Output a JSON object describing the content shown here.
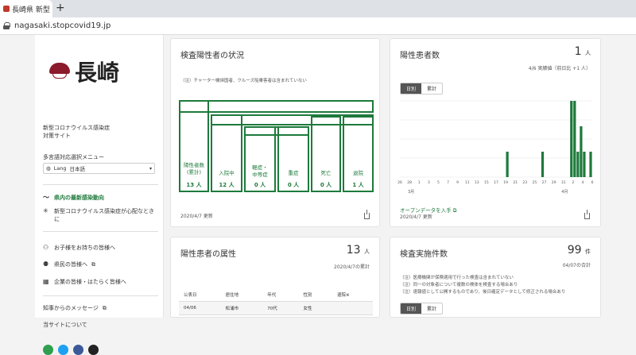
{
  "browser": {
    "tab_title": "長崎県 新型",
    "tab_close": "×",
    "new_tab": "+",
    "url": "nagasaki.stopcovid19.jp"
  },
  "sidebar": {
    "logo_text": "長崎",
    "subtitle_1": "新型コロナウイルス感染症",
    "subtitle_2": "対策サイト",
    "lang_menu_label": "多言語対応選択メニュー",
    "lang_prefix": "Lang",
    "lang_value": "日本語",
    "items": [
      {
        "label": "県内の最新感染動向",
        "icon": "chart-line-icon",
        "glyph": "〜",
        "active": true
      },
      {
        "label": "新型コロナウイルス感染症が心配なときに",
        "icon": "virus-icon",
        "glyph": "✳",
        "active": false
      },
      {
        "label": "お子様をお持ちの皆様へ",
        "icon": "family-icon",
        "glyph": "👪",
        "active": false
      },
      {
        "label": "県民の皆様へ",
        "icon": "people-icon",
        "glyph": "👥",
        "active": false
      },
      {
        "label": "企業の皆様・はたらく皆様へ",
        "icon": "building-icon",
        "glyph": "▦",
        "active": false
      },
      {
        "label": "知事からのメッセージ",
        "icon": "external-link-icon",
        "glyph": "",
        "active": false
      },
      {
        "label": "当サイトについて",
        "icon": "",
        "glyph": "",
        "active": false
      }
    ],
    "social_colors": [
      "#2e9e4f",
      "#1da1f2",
      "#3b5998",
      "#222222"
    ]
  },
  "card_status": {
    "title": "検査陽性者の状況",
    "note": "（注）チャーター機帰国者、クルーズ船乗客者は含まれていない",
    "boxes": [
      {
        "label": "陽性者数\n(累計)",
        "value": "13 人"
      },
      {
        "label": "入院中",
        "value": "12 人"
      },
      {
        "label": "軽症・\n中等症",
        "value": "0 人"
      },
      {
        "label": "重症",
        "value": "0 人"
      },
      {
        "label": "死亡",
        "value": "0 人"
      },
      {
        "label": "退院",
        "value": "1 人"
      }
    ],
    "date": "2020/4/7 更新"
  },
  "card_patients": {
    "title": "陽性患者数",
    "value": "1",
    "unit": "人",
    "subnote": "4/6 実績値（前日比 +1 人）",
    "toggle": [
      "日別",
      "累計"
    ],
    "link": "オープンデータを入手",
    "date": "2020/4/7 更新",
    "accent": "#1e7a3c",
    "chart_data": {
      "type": "bar",
      "categories_label_x": [
        "3月",
        "4月"
      ],
      "tick_labels": [
        "26",
        "28",
        "1",
        "3",
        "5",
        "7",
        "9",
        "11",
        "13",
        "15",
        "17",
        "19",
        "21",
        "23",
        "25",
        "27",
        "29",
        "31",
        "2",
        "4",
        "6"
      ],
      "ylim": [
        0,
        3
      ],
      "values": [
        0,
        0,
        0,
        0,
        0,
        0,
        0,
        0,
        0,
        0,
        0,
        0,
        0,
        0,
        0,
        0,
        0,
        0,
        0,
        0,
        0,
        0,
        0,
        0,
        0,
        0,
        0,
        0,
        0,
        0,
        0,
        0,
        0,
        1,
        0,
        0,
        0,
        0,
        0,
        0,
        0,
        0,
        0,
        0,
        1,
        0,
        0,
        0,
        0,
        0,
        0,
        0,
        0,
        3,
        3,
        1,
        2,
        1,
        0,
        1
      ]
    }
  },
  "card_attr": {
    "title": "陽性患者の属性",
    "value": "13",
    "unit": "人",
    "date": "2020/4/7の累計",
    "headers": [
      "公表日",
      "居住地",
      "年代",
      "性別",
      "退院※"
    ],
    "rows": [
      [
        "04/06",
        "松浦市",
        "70代",
        "女性",
        ""
      ]
    ]
  },
  "card_tests": {
    "title": "検査実施件数",
    "value": "99",
    "unit": "件",
    "date": "04/07の合計",
    "notes": [
      "（注）医療機関が保険適用で行った検査は含まれていない",
      "（注）同一の対象者について複数の検体を検査する場合あり",
      "（注）速報値として公開するものであり、後日確定データとして修正される場合あり"
    ],
    "toggle": [
      "日別",
      "累計"
    ]
  }
}
